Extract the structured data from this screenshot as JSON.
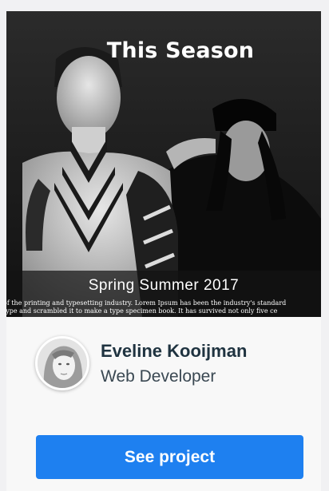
{
  "card": {
    "banner": {
      "title": "This Season",
      "caption_title": "Spring Summer 2017",
      "caption_line_1": "of the printing and typesetting industry. Lorem Ipsum has been the industry's standard",
      "caption_line_2": "type and scrambled it to make a type specimen book. It has survived not only five ce"
    },
    "profile": {
      "name": "Eveline Kooijman",
      "role": "Web Developer",
      "button_label": "See project"
    }
  },
  "colors": {
    "page_background": "#f1f1f3",
    "card_background": "#f8f8f8",
    "button": "#1e80f0",
    "name_text": "#1f3340"
  }
}
